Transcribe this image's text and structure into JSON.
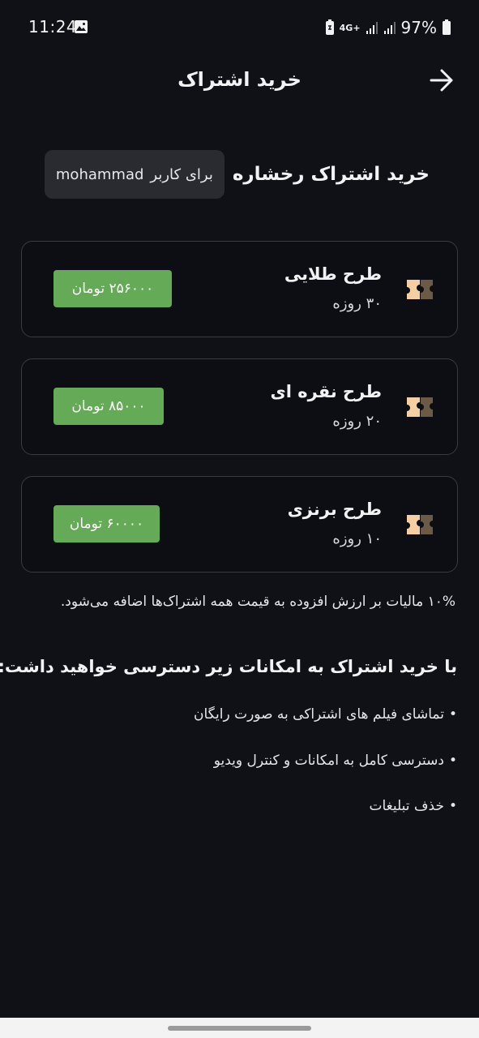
{
  "status_bar": {
    "time": "11:24",
    "network": "4G+",
    "battery": "97%",
    "icons": [
      "image-icon",
      "nfc-icon",
      "signal-icon",
      "battery-icon"
    ]
  },
  "app_bar": {
    "title": "خرید اشتراک",
    "back_icon": "arrow-right-icon"
  },
  "heading": {
    "text": "خرید اشتراک رخشاره",
    "user_prefix": "برای کاربر",
    "username": "mohammad"
  },
  "plans": [
    {
      "name": "طرح طلایی",
      "duration": "۳۰ روزه",
      "price": "۲۵۶۰۰۰ تومان",
      "icon": "ticket-icon"
    },
    {
      "name": "طرح نقره ای",
      "duration": "۲۰ روزه",
      "price": "۸۵۰۰۰ تومان",
      "icon": "ticket-icon"
    },
    {
      "name": "طرح برنزی",
      "duration": "۱۰ روزه",
      "price": "۶۰۰۰۰ تومان",
      "icon": "ticket-icon"
    }
  ],
  "tax_note": "۱۰% مالیات بر ارزش افزوده به قیمت همه اشتراک‌ها اضافه می‌شود.",
  "features": {
    "title": "با خرید اشتراک  به امکانات زیر دسترسی خواهید داشت:",
    "items": [
      "تماشای فیلم های اشتراکی به صورت رایگان",
      "دسترسی کامل به امکانات و کنترل ویدیو",
      "خذف تبلیغات"
    ]
  },
  "colors": {
    "background": "#101117",
    "price_green": "#65ab57",
    "card_border": "#3a3b42",
    "ticket_light": "#f5cfa3",
    "ticket_dark": "#6b5a45"
  }
}
